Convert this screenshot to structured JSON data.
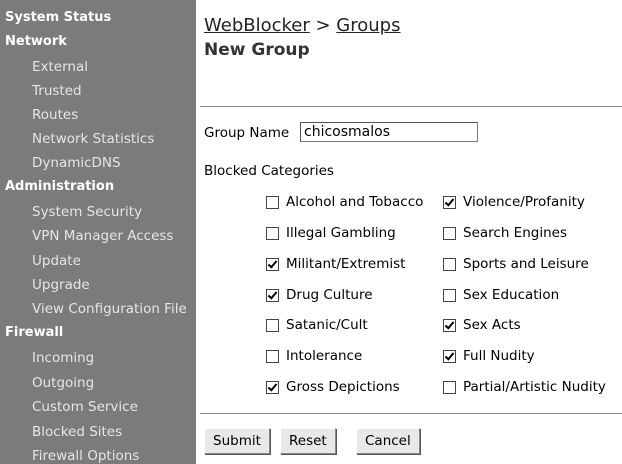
{
  "sidebar": {
    "sections": [
      {
        "title": "System Status",
        "items": []
      },
      {
        "title": "Network",
        "items": [
          "External",
          "Trusted",
          "Routes",
          "Network Statistics",
          "DynamicDNS"
        ]
      },
      {
        "title": "Administration",
        "items": [
          "System Security",
          "VPN Manager Access",
          "Update",
          "Upgrade",
          "View Configuration File"
        ]
      },
      {
        "title": "Firewall",
        "items": [
          "Incoming",
          "Outgoing",
          "Custom Service",
          "Blocked Sites",
          "Firewall Options"
        ]
      }
    ]
  },
  "header": {
    "breadcrumb_link": "WebBlocker",
    "breadcrumb_sep": " > ",
    "breadcrumb_current": "Groups",
    "title": "New Group"
  },
  "form": {
    "group_name_label": "Group Name",
    "group_name_value": "chicosmalos",
    "blocked_categories_label": "Blocked Categories",
    "left_categories": [
      {
        "label": "Alcohol and Tobacco",
        "checked": false
      },
      {
        "label": "Illegal Gambling",
        "checked": false
      },
      {
        "label": "Militant/Extremist",
        "checked": true
      },
      {
        "label": "Drug Culture",
        "checked": true
      },
      {
        "label": "Satanic/Cult",
        "checked": false
      },
      {
        "label": "Intolerance",
        "checked": false
      },
      {
        "label": "Gross Depictions",
        "checked": true
      }
    ],
    "right_categories": [
      {
        "label": "Violence/Profanity",
        "checked": true
      },
      {
        "label": "Search Engines",
        "checked": false
      },
      {
        "label": "Sports and Leisure",
        "checked": false
      },
      {
        "label": "Sex Education",
        "checked": false
      },
      {
        "label": "Sex Acts",
        "checked": true
      },
      {
        "label": "Full Nudity",
        "checked": true
      },
      {
        "label": "Partial/Artistic Nudity",
        "checked": false
      }
    ]
  },
  "buttons": {
    "submit": "Submit",
    "reset": "Reset",
    "cancel": "Cancel"
  }
}
